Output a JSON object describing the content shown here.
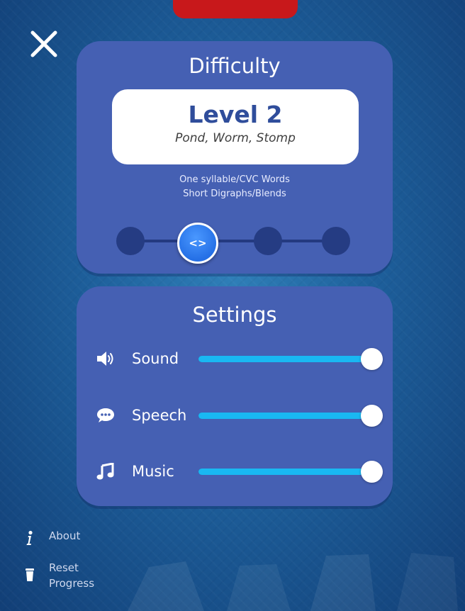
{
  "difficulty": {
    "title": "Difficulty",
    "level_title": "Level 2",
    "level_examples": "Pond, Worm, Stomp",
    "description_line1": "One syllable/CVC Words",
    "description_line2": "Short Digraphs/Blends",
    "levels_total": 4,
    "selected_level": 2,
    "handle_glyph": "<>"
  },
  "settings": {
    "title": "Settings",
    "rows": [
      {
        "label": "Sound",
        "icon": "speaker-icon",
        "level": 1.0
      },
      {
        "label": "Speech",
        "icon": "speech-bubble-icon",
        "level": 1.0
      },
      {
        "label": "Music",
        "icon": "music-note-icon",
        "level": 1.0
      }
    ]
  },
  "footer": {
    "about_label": "About",
    "reset_label_line1": "Reset",
    "reset_label_line2": "Progress"
  },
  "colors": {
    "panel": "#4560b3",
    "slider_fill": "#19b8f2",
    "level_title": "#2f4d9b",
    "top_tab": "#c8181b"
  }
}
